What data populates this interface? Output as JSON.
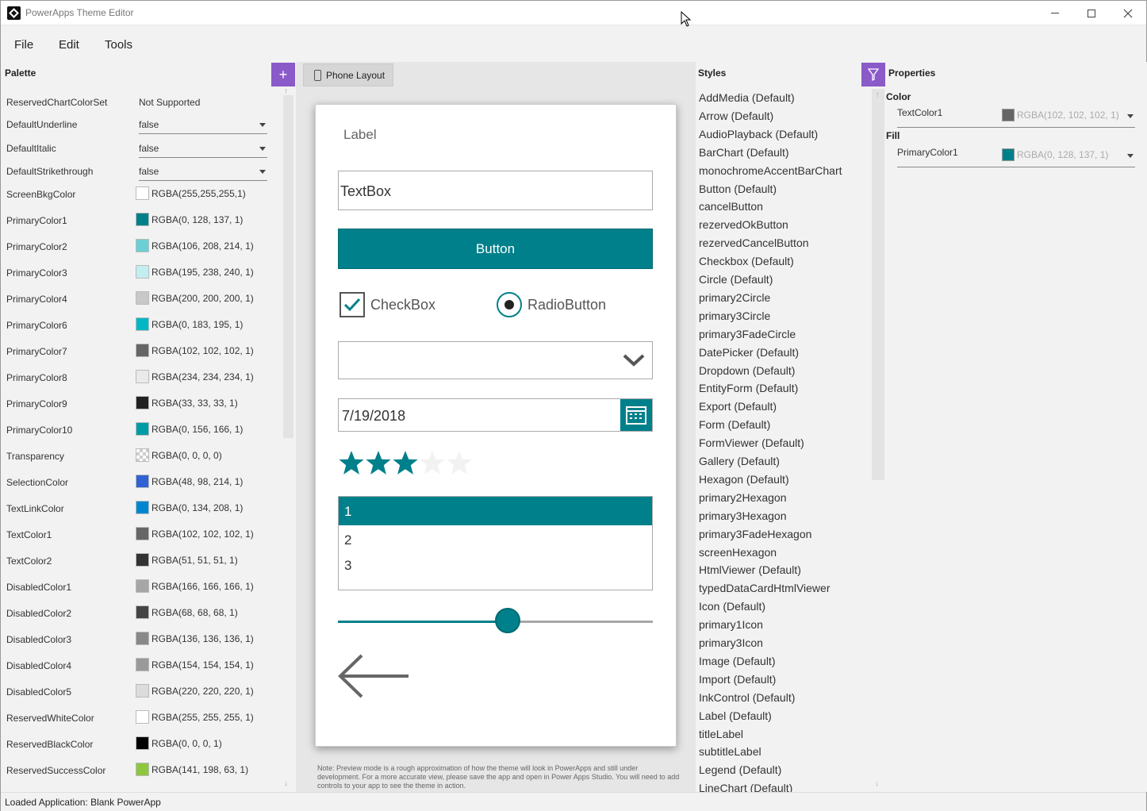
{
  "window": {
    "title": "PowerApps Theme Editor"
  },
  "menu": {
    "file": "File",
    "edit": "Edit",
    "tools": "Tools"
  },
  "palette": {
    "title": "Palette",
    "add_label": "+",
    "reserved_chart_color_set": {
      "name": "ReservedChartColorSet",
      "value": "Not Supported"
    },
    "selects": [
      {
        "name": "DefaultUnderline",
        "value": "false"
      },
      {
        "name": "DefaultItalic",
        "value": "false"
      },
      {
        "name": "DefaultStrikethrough",
        "value": "false"
      }
    ],
    "colors": [
      {
        "name": "ScreenBkgColor",
        "value": "RGBA(255,255,255,1)",
        "hex": "#ffffff"
      },
      {
        "name": "PrimaryColor1",
        "value": "RGBA(0, 128, 137, 1)",
        "hex": "#008089"
      },
      {
        "name": "PrimaryColor2",
        "value": "RGBA(106, 208, 214, 1)",
        "hex": "#6ad0d6"
      },
      {
        "name": "PrimaryColor3",
        "value": "RGBA(195, 238, 240, 1)",
        "hex": "#c3eef0"
      },
      {
        "name": "PrimaryColor4",
        "value": "RGBA(200, 200, 200, 1)",
        "hex": "#c8c8c8"
      },
      {
        "name": "PrimaryColor6",
        "value": "RGBA(0, 183, 195, 1)",
        "hex": "#00b7c3"
      },
      {
        "name": "PrimaryColor7",
        "value": "RGBA(102, 102, 102, 1)",
        "hex": "#666666"
      },
      {
        "name": "PrimaryColor8",
        "value": "RGBA(234, 234, 234, 1)",
        "hex": "#eaeaea"
      },
      {
        "name": "PrimaryColor9",
        "value": "RGBA(33, 33, 33, 1)",
        "hex": "#212121"
      },
      {
        "name": "PrimaryColor10",
        "value": "RGBA(0, 156, 166, 1)",
        "hex": "#009ca6"
      },
      {
        "name": "Transparency",
        "value": "RGBA(0, 0, 0, 0)",
        "hex": "transparent"
      },
      {
        "name": "SelectionColor",
        "value": "RGBA(48, 98, 214, 1)",
        "hex": "#3062d6"
      },
      {
        "name": "TextLinkColor",
        "value": "RGBA(0, 134, 208, 1)",
        "hex": "#0086d0"
      },
      {
        "name": "TextColor1",
        "value": "RGBA(102, 102, 102, 1)",
        "hex": "#666666"
      },
      {
        "name": "TextColor2",
        "value": "RGBA(51, 51, 51, 1)",
        "hex": "#333333"
      },
      {
        "name": "DisabledColor1",
        "value": "RGBA(166, 166, 166, 1)",
        "hex": "#a6a6a6"
      },
      {
        "name": "DisabledColor2",
        "value": "RGBA(68, 68, 68, 1)",
        "hex": "#444444"
      },
      {
        "name": "DisabledColor3",
        "value": "RGBA(136, 136, 136, 1)",
        "hex": "#888888"
      },
      {
        "name": "DisabledColor4",
        "value": "RGBA(154, 154, 154, 1)",
        "hex": "#9a9a9a"
      },
      {
        "name": "DisabledColor5",
        "value": "RGBA(220, 220, 220, 1)",
        "hex": "#dcdcdc"
      },
      {
        "name": "ReservedWhiteColor",
        "value": "RGBA(255, 255, 255, 1)",
        "hex": "#ffffff"
      },
      {
        "name": "ReservedBlackColor",
        "value": "RGBA(0, 0, 0, 1)",
        "hex": "#000000"
      },
      {
        "name": "ReservedSuccessColor",
        "value": "RGBA(141, 198, 63, 1)",
        "hex": "#8dc63f"
      }
    ]
  },
  "preview": {
    "tab_label": "Phone Layout",
    "label": "Label",
    "textbox": "TextBox",
    "button": "Button",
    "checkbox": "CheckBox",
    "radio": "RadioButton",
    "date": "7/19/2018",
    "rating": {
      "value": 3,
      "max": 5
    },
    "list_items": [
      "1",
      "2",
      "3"
    ],
    "slider_value": 0.54,
    "accent": "#00808a",
    "note": "Note: Preview mode is a rough approximation of how the theme will look in PowerApps and still under development. For a more accurate view, please save the app and open in Power Apps Studio. You will need to add controls to your app to see the theme in action."
  },
  "styles": {
    "title": "Styles",
    "items": [
      "AddMedia  (Default)",
      "Arrow  (Default)",
      "AudioPlayback  (Default)",
      "BarChart  (Default)",
      "monochromeAccentBarChart",
      "Button  (Default)",
      "cancelButton",
      "rezervedOkButton",
      "rezervedCancelButton",
      "Checkbox  (Default)",
      "Circle  (Default)",
      "primary2Circle",
      "primary3Circle",
      "primary3FadeCircle",
      "DatePicker  (Default)",
      "Dropdown  (Default)",
      "EntityForm  (Default)",
      "Export  (Default)",
      "Form  (Default)",
      "FormViewer  (Default)",
      "Gallery  (Default)",
      "Hexagon  (Default)",
      "primary2Hexagon",
      "primary3Hexagon",
      "primary3FadeHexagon",
      "screenHexagon",
      "HtmlViewer  (Default)",
      "typedDataCardHtmlViewer",
      "Icon  (Default)",
      "primary1Icon",
      "primary3Icon",
      "Image  (Default)",
      "Import  (Default)",
      "InkControl  (Default)",
      "Label  (Default)",
      "titleLabel",
      "subtitleLabel",
      "Legend  (Default)",
      "LineChart  (Default)"
    ]
  },
  "properties": {
    "title": "Properties",
    "groups": [
      {
        "name": "Color",
        "prop": "TextColor1",
        "value": "RGBA(102, 102, 102, 1)",
        "hex": "#666666"
      },
      {
        "name": "Fill",
        "prop": "PrimaryColor1",
        "value": "RGBA(0, 128, 137, 1)",
        "hex": "#008089"
      }
    ]
  },
  "status": {
    "text": "Loaded Application:  Blank PowerApp"
  }
}
